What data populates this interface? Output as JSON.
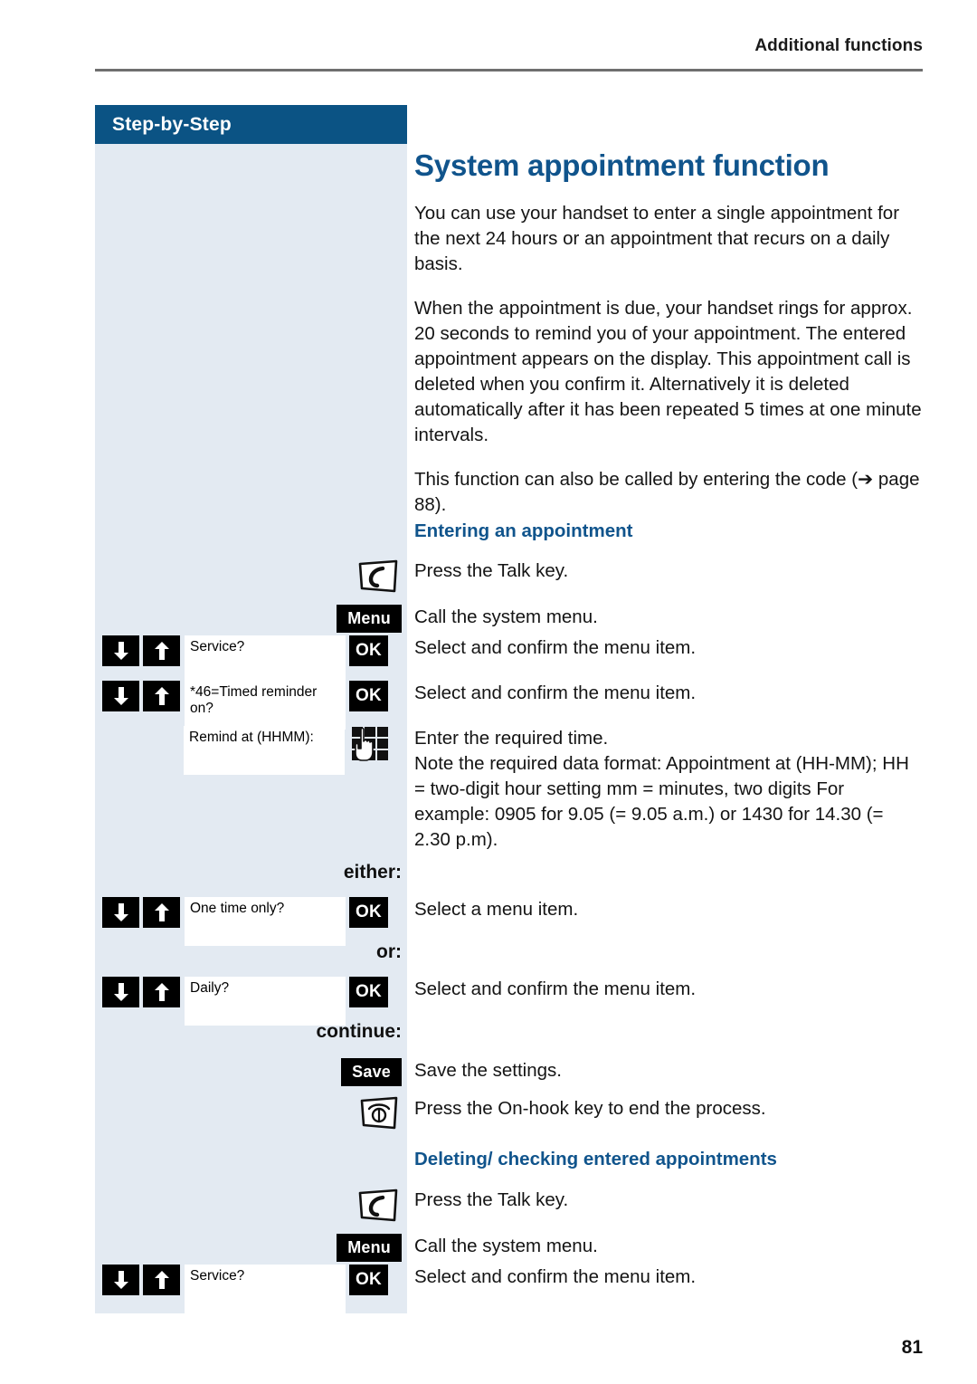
{
  "header": {
    "running_head": "Additional functions"
  },
  "sidebar": {
    "title": "Step-by-Step"
  },
  "page": {
    "title": "System appointment function",
    "folio": "81"
  },
  "intro_paragraphs": [
    "You can use your handset to enter a single appointment for the next 24 hours or an appointment that recurs on a daily basis.",
    "When the appointment is due, your handset rings for approx. 20 seconds to remind you of your appointment. The entered appointment appears on the display. This appointment call is deleted when you confirm it. Alternatively it is deleted automatically after it has been repeated 5 times at one minute intervals.",
    "This function can also be called by entering the code (➔ page 88)."
  ],
  "sections": {
    "entering": {
      "heading": "Entering an appointment",
      "steps": {
        "talk": {
          "icon": "talk-key-icon",
          "desc": "Press the Talk key."
        },
        "menu": {
          "chip": "Menu",
          "desc": "Call the system menu."
        },
        "service": {
          "display": "Service?",
          "ok": "OK",
          "desc": "Select and confirm the menu item."
        },
        "timed_reminder": {
          "display": "*46=Timed reminder on?",
          "ok": "OK",
          "desc": "Select and confirm the menu item."
        },
        "remind_at": {
          "display": "Remind at (HHMM):",
          "icon": "keypad-icon",
          "desc": "Enter the required time.",
          "note": "Note the required data format: Appointment at (HH-MM); HH = two-digit hour setting mm = minutes, two digits For example: 0905 for 9.05 (= 9.05 a.m.) or 1430 for 14.30 (= 2.30 p.m)."
        },
        "either_label": "either:",
        "one_time": {
          "display": "One time only?",
          "ok": "OK",
          "desc": "Select a menu item."
        },
        "or_label": "or:",
        "daily": {
          "display": "Daily?",
          "ok": "OK",
          "desc": "Select and confirm the menu item."
        },
        "continue_label": "continue:",
        "save": {
          "chip": "Save",
          "desc": "Save the settings."
        },
        "onhook": {
          "icon": "on-hook-key-icon",
          "desc": "Press the On-hook key to end the process."
        }
      }
    },
    "deleting": {
      "heading": "Deleting/ checking entered appointments",
      "steps": {
        "talk": {
          "icon": "talk-key-icon",
          "desc": "Press the Talk key."
        },
        "menu": {
          "chip": "Menu",
          "desc": "Call the system menu."
        },
        "service": {
          "display": "Service?",
          "ok": "OK",
          "desc": "Select and confirm the menu item."
        }
      }
    }
  },
  "arrows": {
    "down": "arrow-down-icon",
    "up": "arrow-up-icon"
  },
  "colors": {
    "brand_blue": "#0b5384",
    "heading_blue": "#10548c",
    "sidebar_bg": "#e3eaf2",
    "rule": "#6f6f6f"
  }
}
